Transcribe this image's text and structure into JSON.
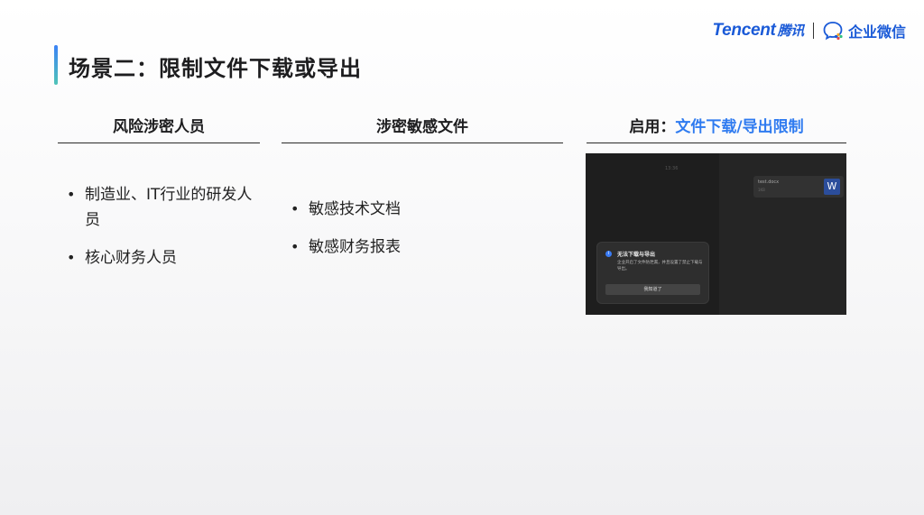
{
  "brand": {
    "tencent_en": "Tencent",
    "tencent_cn": "腾讯",
    "wework": "企业微信"
  },
  "page": {
    "title": "场景二：限制文件下载或导出"
  },
  "columns": {
    "risk_people": {
      "header": "风险涉密人员",
      "items": [
        "制造业、IT行业的研发人员",
        "核心财务人员"
      ]
    },
    "sensitive_files": {
      "header": "涉密敏感文件",
      "items": [
        "敏感技术文档",
        "敏感财务报表"
      ]
    },
    "enable": {
      "header_prefix": "启用：",
      "header_accent": "文件下载/导出限制"
    }
  },
  "screenshot": {
    "faint_label": "13:36",
    "file_name": "test.docx",
    "file_meta": "1KB",
    "file_icon": "W",
    "dialog": {
      "title": "无法下载与导出",
      "message": "企业开启了文件防泄漏，并且设置了禁止下载与导出。",
      "button": "我知道了",
      "icon": "i"
    }
  },
  "colors": {
    "accent": "#2f7bf0",
    "brand_blue": "#1a5ad7",
    "title_bar_top": "#3b82f6",
    "title_bar_bottom": "#4fc4b8"
  }
}
